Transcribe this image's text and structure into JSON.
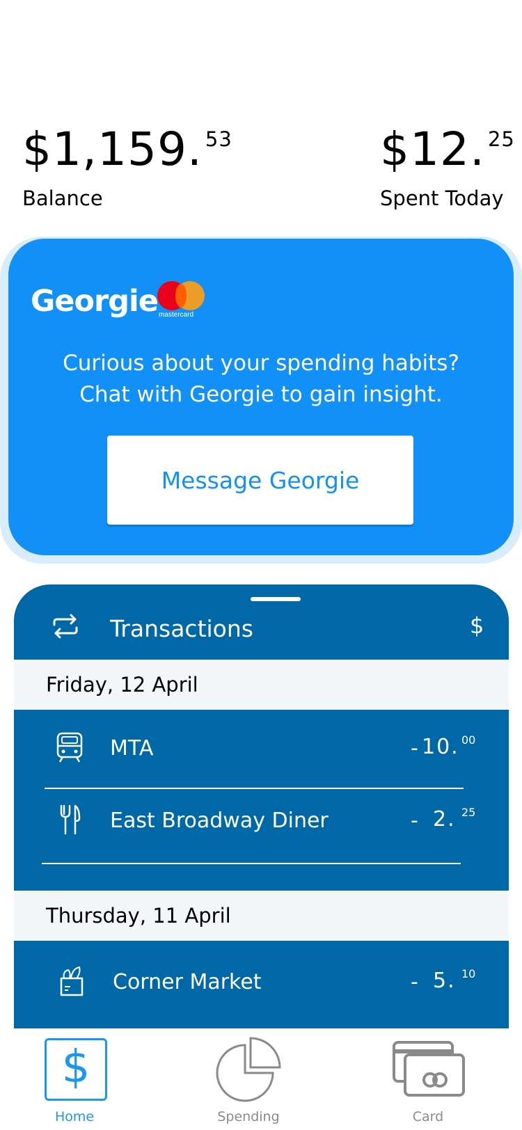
{
  "summary": {
    "balance_main": "$1,159.",
    "balance_cents": "53",
    "balance_label": "Balance",
    "spent_main": "$12.",
    "spent_cents": "25",
    "spent_label": "Spent Today"
  },
  "promo": {
    "brand": "Georgie",
    "card_network": "mastercard",
    "line1": "Curious about your spending habits?",
    "line2": "Chat with Georgie to gain insight.",
    "button_label": "Message Georgie",
    "colors": {
      "card_bg": "#1190f7",
      "button_text": "#1190f7"
    }
  },
  "transactions": {
    "title": "Transactions",
    "currency_symbol": "$",
    "header_icon": "repeat-arrows-icon",
    "groups": [
      {
        "date": "Friday, 12 April",
        "items": [
          {
            "name": "MTA",
            "icon": "train-icon",
            "sign": "-",
            "amount": "10.",
            "cents": "00"
          },
          {
            "name": "East Broadway Diner",
            "icon": "fork-knife-icon",
            "sign": "-",
            "amount": "2.",
            "cents": "25"
          }
        ]
      },
      {
        "date": "Thursday, 11 April",
        "items": [
          {
            "name": "Corner Market",
            "icon": "grocery-bag-icon",
            "sign": "-",
            "amount": "5.",
            "cents": "10"
          }
        ]
      }
    ],
    "colors": {
      "panel_bg": "#0068a7",
      "day_bg": "#f3f6f8"
    }
  },
  "tabbar": {
    "tabs": [
      {
        "label": "Home",
        "icon": "dollar-icon",
        "active": true
      },
      {
        "label": "Spending",
        "icon": "pie-chart-icon",
        "active": false
      },
      {
        "label": "Card",
        "icon": "credit-cards-icon",
        "active": false
      }
    ],
    "colors": {
      "active": "#1a96f3",
      "inactive": "#8a8a8a"
    }
  }
}
